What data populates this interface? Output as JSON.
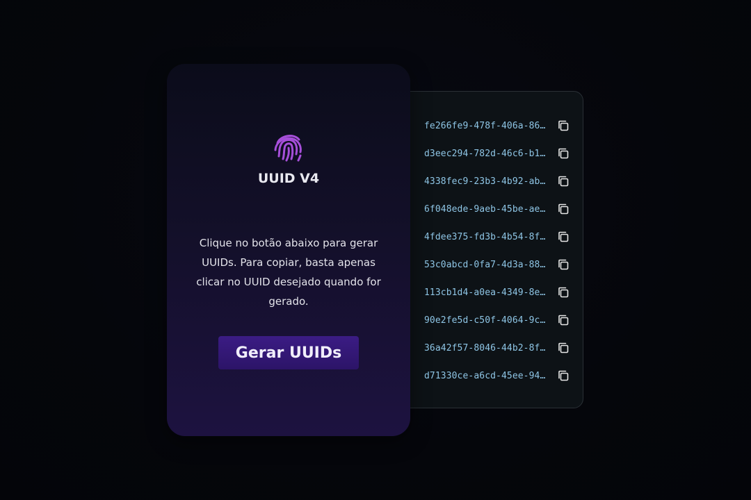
{
  "colors": {
    "background": "#05060b",
    "card_gradient_top": "#0b0c1a",
    "card_gradient_bottom": "#1d1240",
    "accent_purple": "#a64fd9",
    "button": "#341a77",
    "uuid_text": "#8fc6e6"
  },
  "card": {
    "icon": "fingerprint-icon",
    "title": "UUID V4",
    "description": "Clique no botão abaixo para gerar UUIDs. Para copiar, basta apenas clicar no UUID desejado quando for gerado.",
    "button_label": "Gerar UUIDs"
  },
  "uuid_list": {
    "copy_icon": "copy-icon",
    "items": [
      "fe266fe9-478f-406a-86…",
      "d3eec294-782d-46c6-b1…",
      "4338fec9-23b3-4b92-ab…",
      "6f048ede-9aeb-45be-ae…",
      "4fdee375-fd3b-4b54-8f…",
      "53c0abcd-0fa7-4d3a-88…",
      "113cb1d4-a0ea-4349-8e…",
      "90e2fe5d-c50f-4064-9c…",
      "36a42f57-8046-44b2-8f…",
      "d71330ce-a6cd-45ee-94…"
    ]
  }
}
